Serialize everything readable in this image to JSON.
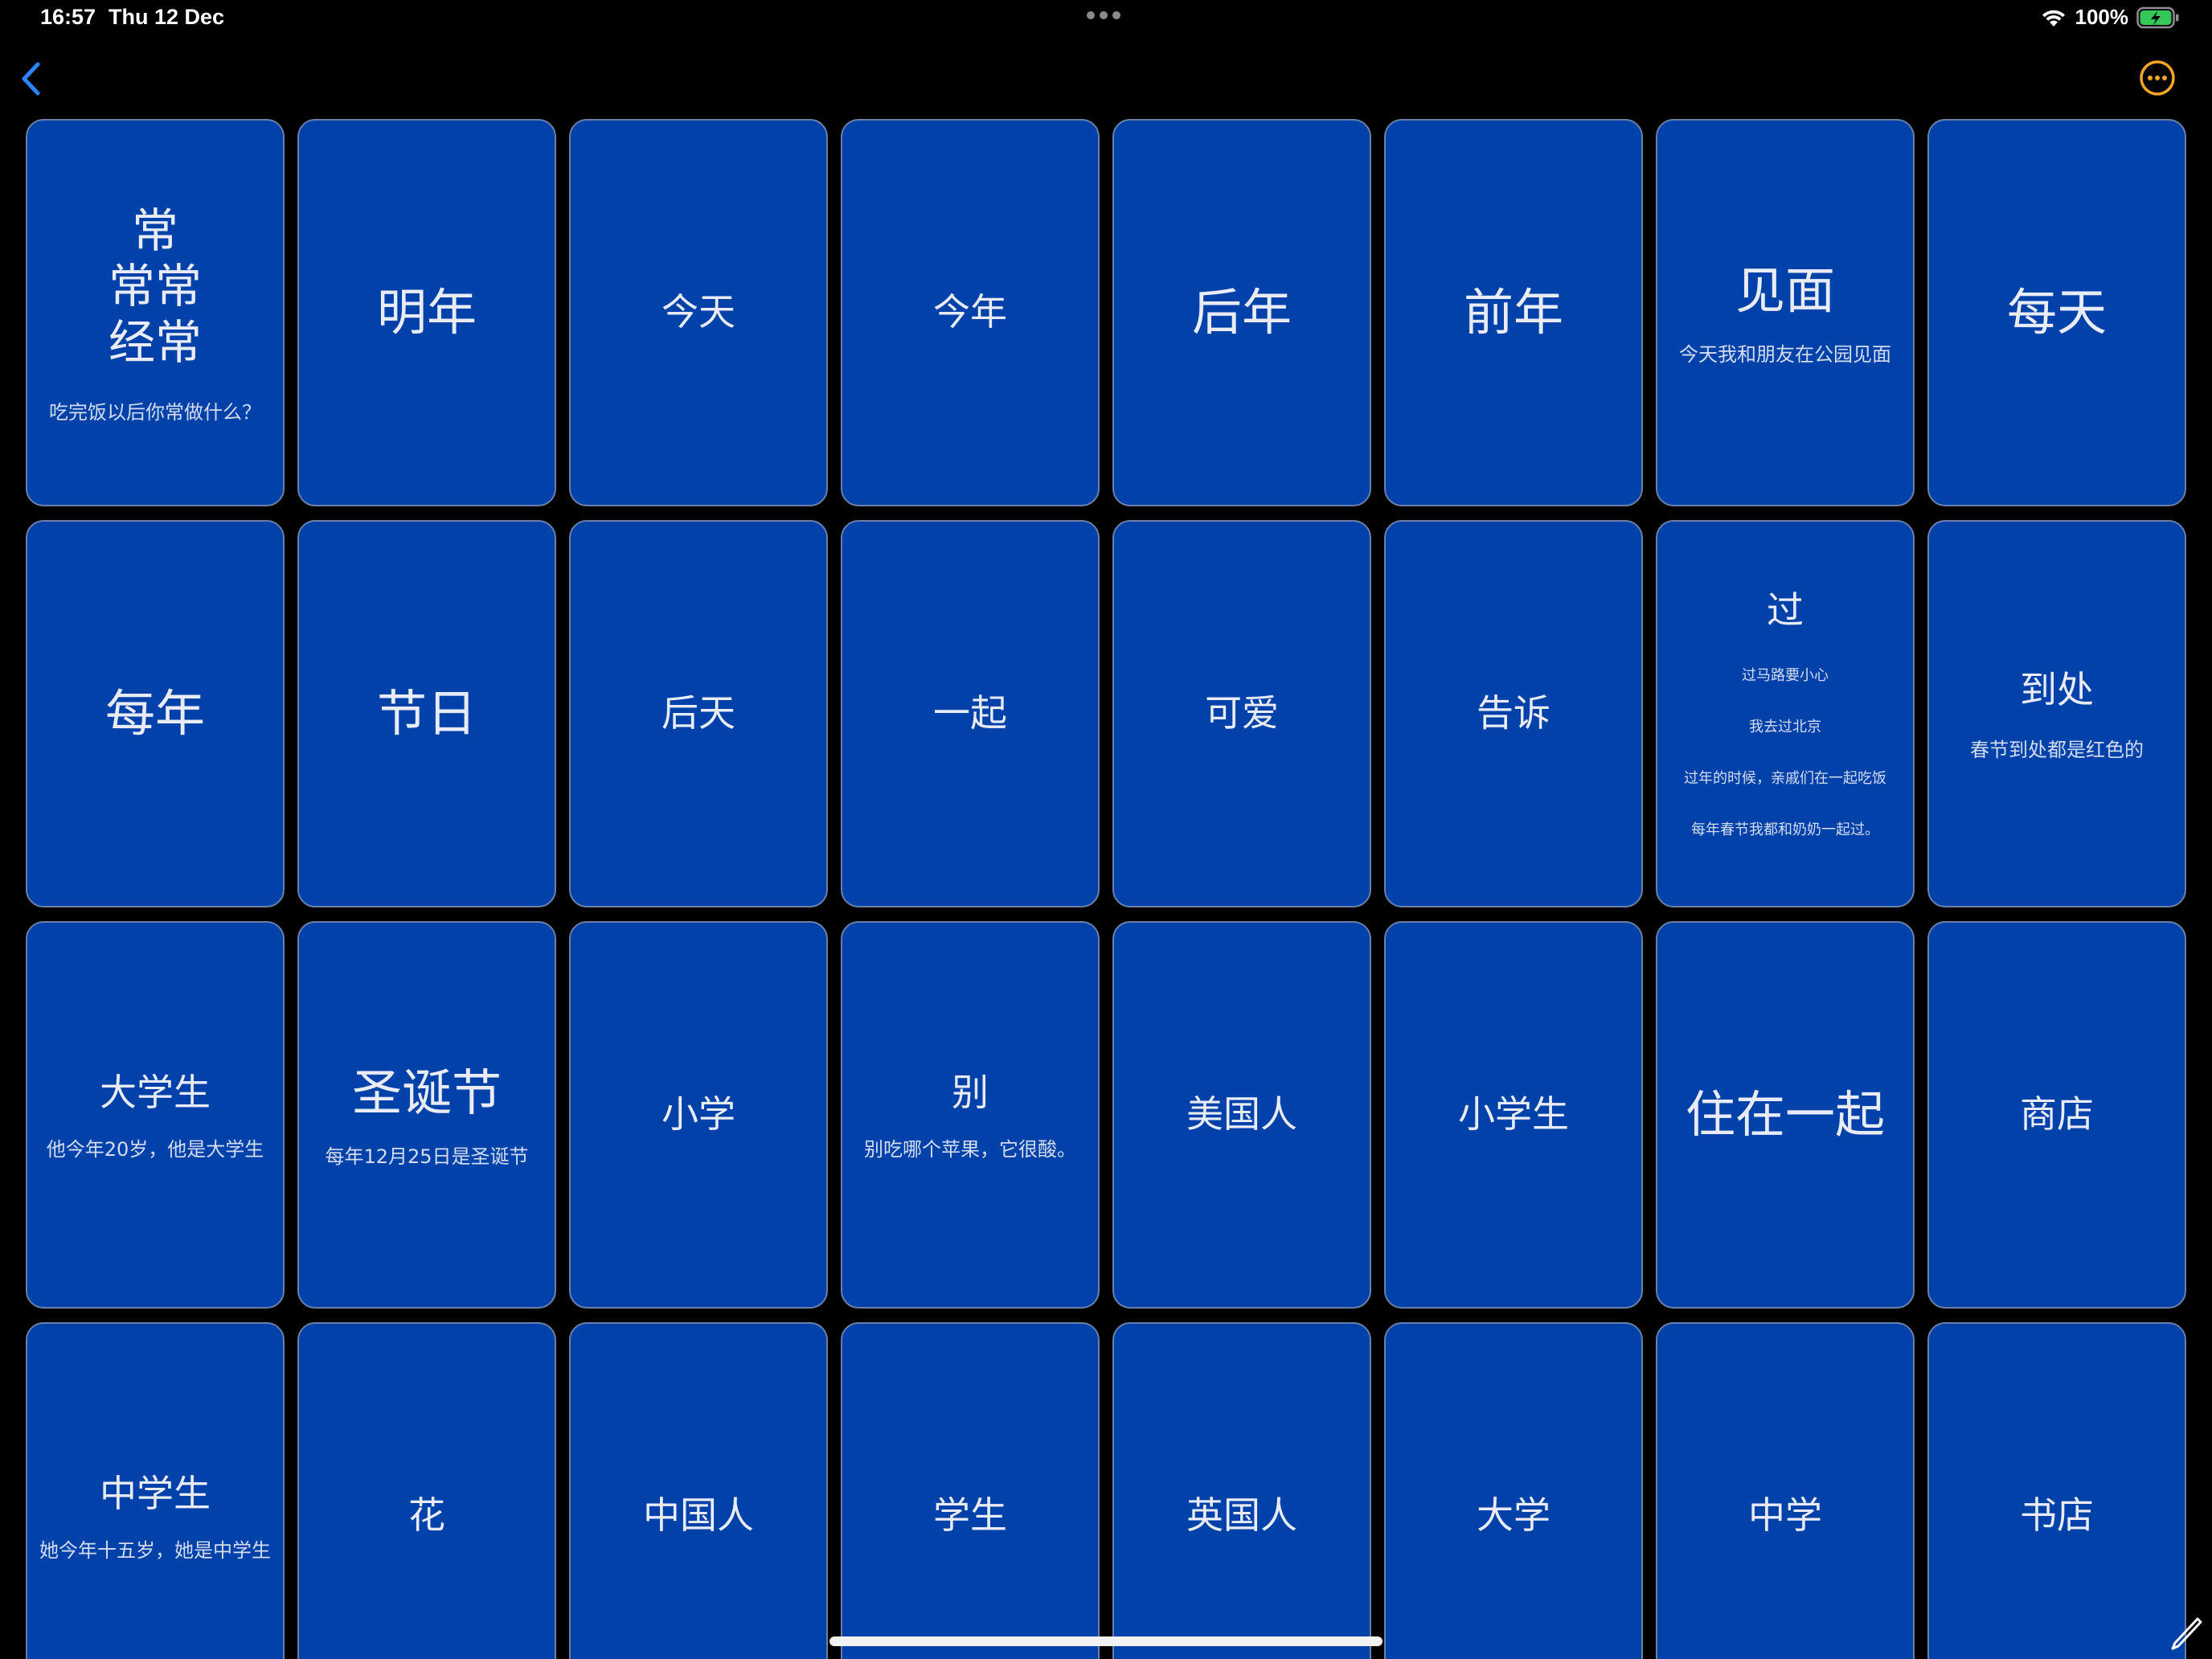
{
  "status_bar": {
    "time": "16:57",
    "date": "Thu 12 Dec",
    "battery": "100%"
  },
  "nav": {
    "back_icon": "chevron-left-icon",
    "more_icon": "ellipsis-circle-icon",
    "accent_back": "#2a84ff",
    "accent_more": "#f5a623"
  },
  "colors": {
    "card_background": "#0042a9",
    "card_border": "#6c7fa8",
    "screen_background": "#000000"
  },
  "cards": [
    {
      "term": "常\n常常\n经常",
      "example": "吃完饭以后你常做什么？"
    },
    {
      "term": "明年"
    },
    {
      "term": "今天"
    },
    {
      "term": "今年"
    },
    {
      "term": "后年"
    },
    {
      "term": "前年"
    },
    {
      "term": "见面",
      "example": "今天我和朋友在公园见面"
    },
    {
      "term": "每天"
    },
    {
      "term": "每年"
    },
    {
      "term": "节日"
    },
    {
      "term": "后天"
    },
    {
      "term": "一起"
    },
    {
      "term": "可爱"
    },
    {
      "term": "告诉"
    },
    {
      "term": "过",
      "examples": [
        "过马路要小心",
        "我去过北京",
        "过年的时候，亲戚们在一起吃饭",
        "每年春节我都和奶奶一起过。"
      ]
    },
    {
      "term": "到处",
      "example": "春节到处都是红色的"
    },
    {
      "term": "大学生",
      "example": "他今年20岁，他是大学生"
    },
    {
      "term": "圣诞节",
      "example": "每年12月25日是圣诞节"
    },
    {
      "term": "小学"
    },
    {
      "term": "别",
      "example": "别吃哪个苹果，它很酸。"
    },
    {
      "term": "美国人"
    },
    {
      "term": "小学生"
    },
    {
      "term": "住在一起"
    },
    {
      "term": "商店"
    },
    {
      "term": "中学生",
      "example": "她今年十五岁，她是中学生"
    },
    {
      "term": "花"
    },
    {
      "term": "中国人"
    },
    {
      "term": "学生"
    },
    {
      "term": "英国人"
    },
    {
      "term": "大学"
    },
    {
      "term": "中学"
    },
    {
      "term": "书店"
    }
  ]
}
